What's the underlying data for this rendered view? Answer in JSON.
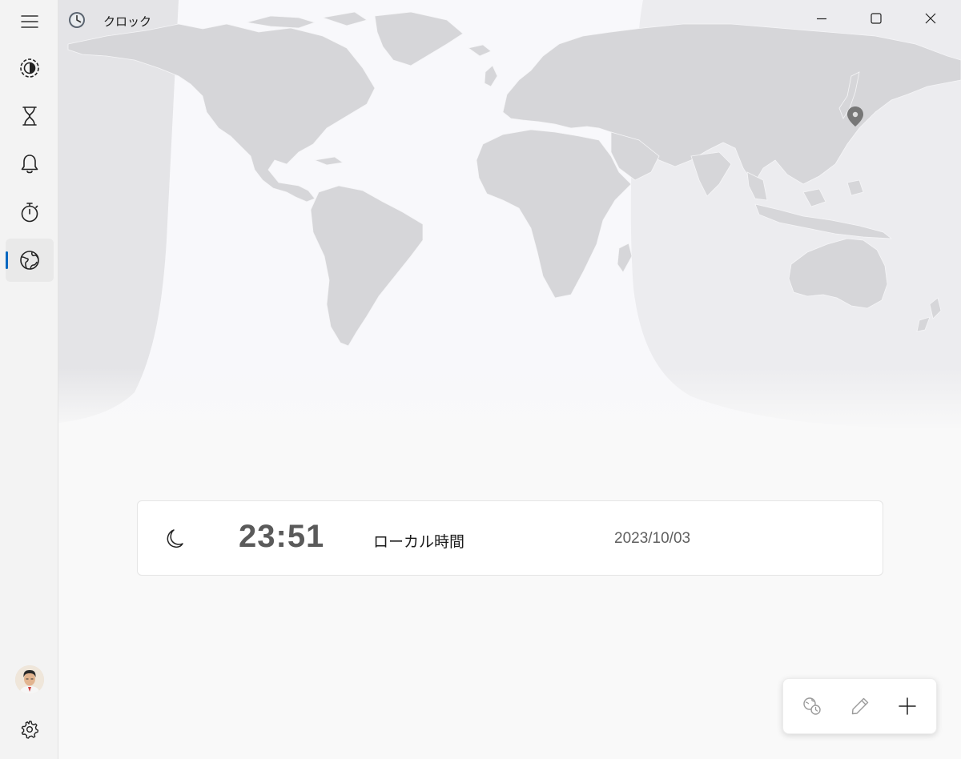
{
  "app": {
    "title": "クロック"
  },
  "nav": {
    "items": [
      {
        "icon": "focus-icon"
      },
      {
        "icon": "timer-icon"
      },
      {
        "icon": "alarm-icon"
      },
      {
        "icon": "stopwatch-icon"
      },
      {
        "icon": "world-clock-icon",
        "selected": true
      }
    ],
    "accent": "#0067c0"
  },
  "world_clock": {
    "local": {
      "time": "23:51",
      "label": "ローカル時間",
      "date": "2023/10/03",
      "icon": "moon-icon"
    }
  },
  "commands": [
    {
      "icon": "compare-time-icon"
    },
    {
      "icon": "edit-icon"
    },
    {
      "icon": "add-icon"
    }
  ]
}
